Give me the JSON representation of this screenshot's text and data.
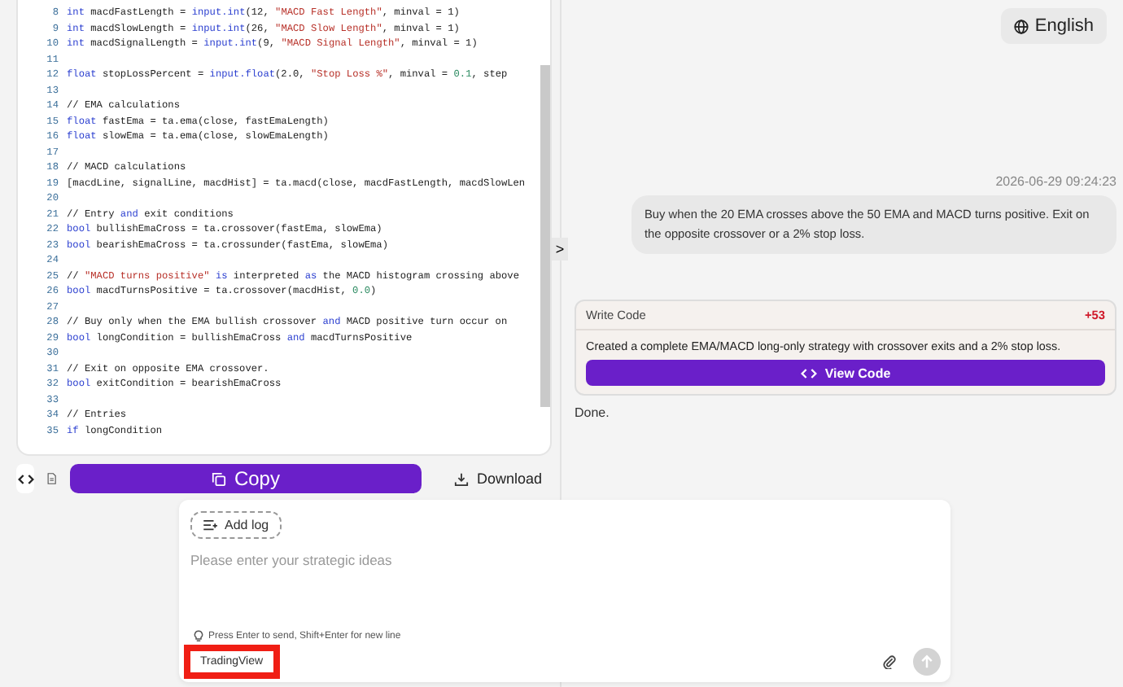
{
  "code": {
    "lines": [
      {
        "number": "8",
        "segments": [
          {
            "kind": "keyword",
            "text": "int"
          },
          {
            "text": " macdFastLength = "
          },
          {
            "kind": "keyword",
            "text": "input.int"
          },
          {
            "text": "(12, "
          },
          {
            "kind": "string",
            "text": "\"MACD Fast Length\""
          },
          {
            "text": ", minval = 1)"
          }
        ]
      },
      {
        "number": "9",
        "segments": [
          {
            "kind": "keyword",
            "text": "int"
          },
          {
            "text": " macdSlowLength = "
          },
          {
            "kind": "keyword",
            "text": "input.int"
          },
          {
            "text": "(26, "
          },
          {
            "kind": "string",
            "text": "\"MACD Slow Length\""
          },
          {
            "text": ", minval = 1)"
          }
        ]
      },
      {
        "number": "10",
        "segments": [
          {
            "kind": "keyword",
            "text": "int"
          },
          {
            "text": " macdSignalLength = "
          },
          {
            "kind": "keyword",
            "text": "input.int"
          },
          {
            "text": "(9, "
          },
          {
            "kind": "string",
            "text": "\"MACD Signal Length\""
          },
          {
            "text": ", minval = 1)"
          }
        ]
      },
      {
        "number": "11"
      },
      {
        "number": "12",
        "segments": [
          {
            "kind": "keyword",
            "text": "float"
          },
          {
            "text": " stopLossPercent = "
          },
          {
            "kind": "keyword",
            "text": "input.float"
          },
          {
            "text": "(2.0, "
          },
          {
            "kind": "string",
            "text": "\"Stop Loss %\""
          },
          {
            "text": ", minval = "
          },
          {
            "kind": "number",
            "text": "0.1"
          },
          {
            "text": ", step"
          }
        ]
      },
      {
        "number": "13"
      },
      {
        "number": "14",
        "segments": [
          {
            "text": "// EMA calculations"
          }
        ]
      },
      {
        "number": "15",
        "segments": [
          {
            "kind": "keyword",
            "text": "float"
          },
          {
            "text": " fastEma = ta.ema(close, fastEmaLength)"
          }
        ]
      },
      {
        "number": "16",
        "segments": [
          {
            "kind": "keyword",
            "text": "float"
          },
          {
            "text": " slowEma = ta.ema(close, slowEmaLength)"
          }
        ]
      },
      {
        "number": "17"
      },
      {
        "number": "18",
        "segments": [
          {
            "text": "// MACD calculations"
          }
        ]
      },
      {
        "number": "19",
        "segments": [
          {
            "text": "[macdLine, signalLine, macdHist] = ta.macd(close, macdFastLength, macdSlowLen"
          }
        ]
      },
      {
        "number": "20"
      },
      {
        "number": "21",
        "segments": [
          {
            "text": "// Entry "
          },
          {
            "kind": "keyword",
            "text": "and"
          },
          {
            "text": " exit conditions"
          }
        ]
      },
      {
        "number": "22",
        "segments": [
          {
            "kind": "keyword",
            "text": "bool"
          },
          {
            "text": " bullishEmaCross = ta.crossover(fastEma, slowEma)"
          }
        ]
      },
      {
        "number": "23",
        "segments": [
          {
            "kind": "keyword",
            "text": "bool"
          },
          {
            "text": " bearishEmaCross = ta.crossunder(fastEma, slowEma)"
          }
        ]
      },
      {
        "number": "24"
      },
      {
        "number": "25",
        "segments": [
          {
            "text": "// "
          },
          {
            "kind": "string",
            "text": "\"MACD turns positive\""
          },
          {
            "kind": "keyword",
            "text": " is"
          },
          {
            "text": " interpreted "
          },
          {
            "kind": "keyword",
            "text": "as"
          },
          {
            "text": " the MACD histogram crossing above"
          }
        ]
      },
      {
        "number": "26",
        "segments": [
          {
            "kind": "keyword",
            "text": "bool"
          },
          {
            "text": " macdTurnsPositive = ta.crossover(macdHist, "
          },
          {
            "kind": "number",
            "text": "0.0"
          },
          {
            "text": ")"
          }
        ]
      },
      {
        "number": "27"
      },
      {
        "number": "28",
        "segments": [
          {
            "text": "// Buy only when the EMA bullish crossover "
          },
          {
            "kind": "keyword",
            "text": "and"
          },
          {
            "text": " MACD positive turn occur on"
          }
        ]
      },
      {
        "number": "29",
        "segments": [
          {
            "kind": "keyword",
            "text": "bool"
          },
          {
            "text": " longCondition = bullishEmaCross "
          },
          {
            "kind": "keyword",
            "text": "and"
          },
          {
            "text": " macdTurnsPositive"
          }
        ]
      },
      {
        "number": "30"
      },
      {
        "number": "31",
        "segments": [
          {
            "text": "// Exit on opposite EMA crossover."
          }
        ]
      },
      {
        "number": "32",
        "segments": [
          {
            "kind": "keyword",
            "text": "bool"
          },
          {
            "text": " exitCondition = bearishEmaCross"
          }
        ]
      },
      {
        "number": "33"
      },
      {
        "number": "34",
        "segments": [
          {
            "text": "// Entries"
          }
        ]
      },
      {
        "number": "35",
        "segments": [
          {
            "kind": "keyword",
            "text": "if"
          },
          {
            "text": " longCondition"
          }
        ]
      }
    ]
  },
  "code_toolbar": {
    "copy_button": "Copy",
    "download_button": "Download"
  },
  "collapse_toggle": ">",
  "language_button": "English",
  "chat": {
    "timestamp": "2026-06-29 09:24:23",
    "user_message": "Buy when the 20 EMA crosses above the 50 EMA and MACD turns positive. Exit on the opposite crossover or a 2% stop loss.",
    "tool_card": {
      "title": "Write Code",
      "diff": "+53",
      "summary": "Created a complete EMA/MACD long-only strategy with crossover exits and a 2% stop loss.",
      "button": "View Code"
    },
    "status": "Done."
  },
  "composer": {
    "add_log_button": "Add log",
    "placeholder": "Please enter your strategic ideas",
    "hint": "Press Enter to send, Shift+Enter for new line",
    "source_tag": {
      "label": "TradingView",
      "highlighted": true
    }
  }
}
